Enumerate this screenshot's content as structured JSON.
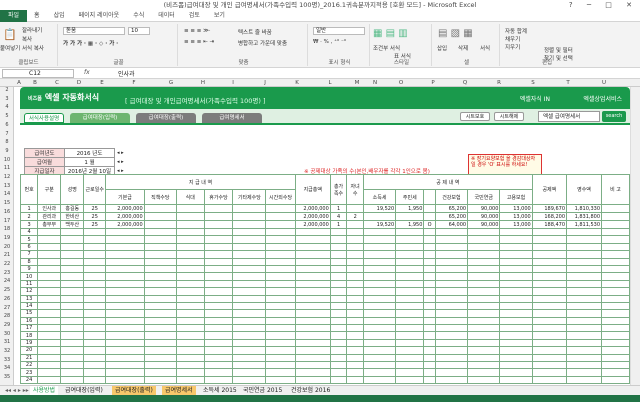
{
  "window": {
    "title": "(비즈폼)급여대장 및 개인 급여명세서(가족수입력 100명)_2016.1귀속분까지적용 [호환 모드] - Microsoft Excel",
    "controls": "? ─ □ ✕"
  },
  "tabs": [
    "파일",
    "홈",
    "삽입",
    "페이지 레이아웃",
    "수식",
    "데이터",
    "검토",
    "보기"
  ],
  "ribbon": {
    "paste": "붙여넣기",
    "cut": "잘라내기",
    "copy": "복사",
    "format": "서식 복사",
    "clipboard": "클립보드",
    "font_name": "돋움",
    "font_size": "10",
    "font": "글꼴",
    "align": "맞춤",
    "wrap": "텍스트 줄 바꿈",
    "merge": "병합하고 가운데 맞춤",
    "number_fmt": "일반",
    "number": "표시 형식",
    "cond": "조건부 서식",
    "table_fmt": "표 서식",
    "cell_style": "셀 스타일",
    "style": "스타일",
    "insert": "삽입",
    "delete": "삭제",
    "format_btn": "서식",
    "cells": "셀",
    "autosum": "자동 합계",
    "fill": "채우기",
    "clear": "지우기",
    "sort": "정렬 및 필터",
    "find": "찾기 및 선택",
    "edit": "편집"
  },
  "formula": {
    "cell": "C12",
    "fx": "fx",
    "value": "인사과"
  },
  "columns": [
    "A",
    "B",
    "C",
    "D",
    "E",
    "F",
    "G",
    "H",
    "I",
    "J",
    "K",
    "L",
    "M",
    "N",
    "O",
    "P",
    "Q",
    "R",
    "S",
    "T",
    "U"
  ],
  "rows": [
    "2",
    "3",
    "4",
    "5",
    "6",
    "7",
    "8",
    "9",
    "10",
    "11",
    "12",
    "13",
    "14",
    "15",
    "16",
    "17",
    "18",
    "19",
    "20",
    "21",
    "22",
    "23",
    "24",
    "25",
    "26",
    "27",
    "28",
    "29",
    "30",
    "31",
    "32",
    "33",
    "34",
    "35"
  ],
  "banner": {
    "brand_small": "비즈폼",
    "brand": "엑셀 자동화서식",
    "subtitle": "[ 급여대장 및 개인급여명세서(가족수입력 100명) ]",
    "link1": "엑셀자식 IN",
    "link2": "엑셀상업서비스"
  },
  "nav": {
    "tab0": "서식사용설명",
    "tab1": "급여대장(입력)",
    "tab2": "급여대장(출력)",
    "tab3": "급여명세서",
    "btn1": "시트보호",
    "btn2": "시트해제",
    "search_placeholder": "엑셀 급여명세서",
    "search_btn": "search"
  },
  "info": {
    "rows": [
      {
        "label": "급여년도",
        "value": "2016 년도"
      },
      {
        "label": "급여월",
        "value": "1 월"
      },
      {
        "label": "지급일자",
        "value": "2016년 2월 10일"
      }
    ]
  },
  "note": "※ 장기요양보험 을 경감대상자일 경우 'O' 표시를 하세요!",
  "warning": "※ 공제대상 가족의 수(본인,배우자를 각각 1인으로 봄)",
  "headers": {
    "no": "번호",
    "dept": "구분",
    "name": "성명",
    "days": "근로일수",
    "pay": "지 급 내 역",
    "base": "기본급",
    "position": "직책수당",
    "meal": "식대",
    "overtime": "휴가수당",
    "other": "기타제수당",
    "night": "시간외수당",
    "total": "지급총액",
    "family": "총가족수",
    "children": "자녀수",
    "deduct": "공 제 내 역",
    "income": "소득세",
    "resident": "주민세",
    "health": "건강보험",
    "care": "",
    "pension": "국민연금",
    "employ": "고용보험",
    "deduct_total": "공제액",
    "net": "영수액",
    "remark": "비 고"
  },
  "data": [
    {
      "no": "1",
      "dept": "인사과",
      "name": "홍길동",
      "days": "25",
      "base": "2,000,000",
      "total": "2,000,000",
      "family": "1",
      "children": "",
      "income": "19,520",
      "resident": "1,950",
      "care": "",
      "health": "65,200",
      "pension": "90,000",
      "employ": "13,000",
      "deduct_total": "189,670",
      "net": "1,810,330"
    },
    {
      "no": "2",
      "dept": "관리과",
      "name": "한비산",
      "days": "25",
      "base": "2,000,000",
      "total": "2,000,000",
      "family": "4",
      "children": "2",
      "income": "",
      "resident": "",
      "care": "",
      "health": "65,200",
      "pension": "90,000",
      "employ": "13,000",
      "deduct_total": "168,200",
      "net": "1,831,800"
    },
    {
      "no": "3",
      "dept": "총무부",
      "name": "백두산",
      "days": "25",
      "base": "2,000,000",
      "total": "2,000,000",
      "family": "1",
      "children": "",
      "income": "19,520",
      "resident": "1,950",
      "care": "O",
      "health": "64,000",
      "pension": "90,000",
      "employ": "13,000",
      "deduct_total": "188,470",
      "net": "1,811,530"
    }
  ],
  "sheet_tabs": [
    "사용방법",
    "급여대장(입력)",
    "급여대장(출력)",
    "급여명세서",
    "소득세 2015",
    "국민연금 2015",
    "건강보험 2016"
  ],
  "colors": {
    "green": "#1a9a4c",
    "excel": "#217346"
  }
}
